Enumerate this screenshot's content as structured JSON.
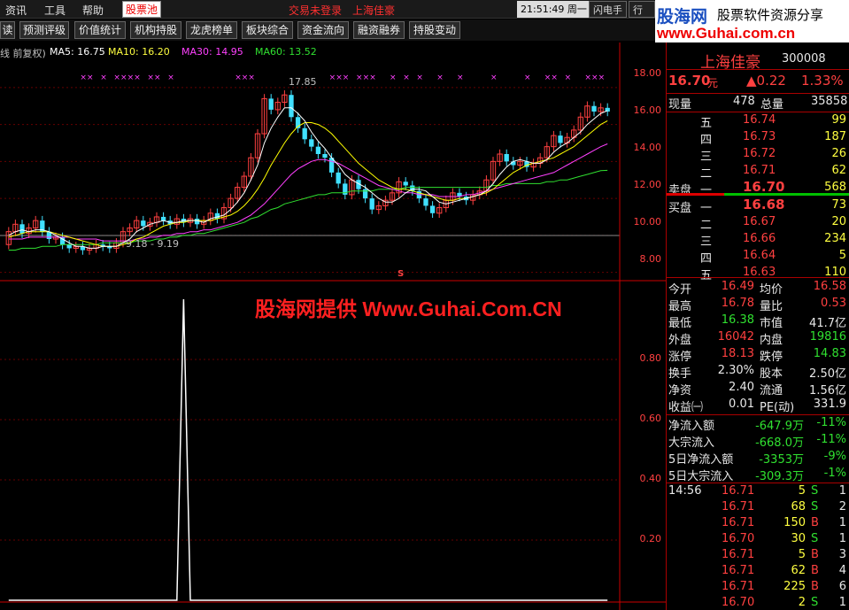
{
  "menu": {
    "items": [
      "资讯",
      "工具",
      "帮助"
    ],
    "active_tab": "股票池",
    "login_status": "交易未登录",
    "stock_title": "上海佳豪",
    "clock": "21:51:49 周一",
    "btn_flash": "闪电手",
    "btn_quote": "行情"
  },
  "toolbar": {
    "buttons": [
      "读",
      "预测评级",
      "价值统计",
      "机构持股",
      "龙虎榜单",
      "板块综合",
      "资金流向",
      "融资融券",
      "持股变动"
    ]
  },
  "logo": {
    "brand": "股海网",
    "tagline": "股票软件资源分享",
    "url": "www.Guhai.com.cn"
  },
  "legend": {
    "prefix": "线 前复权)",
    "ma5": "MA5: 16.75",
    "ma10": "MA10: 16.20",
    "ma30": "MA30: 14.95",
    "ma60": "MA60: 13.52"
  },
  "annotations": {
    "high": "17.85",
    "low": "9.18 - 9.19",
    "marker": "S"
  },
  "watermark": "股海网提供 Www.Guhai.Com.CN",
  "price_axis": [
    "18.00",
    "16.00",
    "14.00",
    "12.00",
    "10.00",
    "8.00"
  ],
  "indicator_axis": [
    "0.80",
    "0.60",
    "0.40",
    "0.20"
  ],
  "colors": {
    "up": "#ff4040",
    "down": "#40e0ff",
    "ma5": "#ffffff",
    "ma10": "#ffff00",
    "ma30": "#ff40ff",
    "ma60": "#30e030"
  },
  "quote": {
    "name": "上海佳豪",
    "code": "300008",
    "price": "16.70",
    "unit": "元",
    "change": "▲0.22",
    "pct": "1.33%",
    "now_vol_label": "现量",
    "now_vol": "478",
    "total_vol_label": "总量",
    "total_vol": "35858",
    "sell_label": "卖盘",
    "buy_label": "买盘",
    "asks": [
      {
        "level": "五",
        "price": "16.74",
        "vol": "99"
      },
      {
        "level": "四",
        "price": "16.73",
        "vol": "187"
      },
      {
        "level": "三",
        "price": "16.72",
        "vol": "26"
      },
      {
        "level": "二",
        "price": "16.71",
        "vol": "62"
      },
      {
        "level": "一",
        "price": "16.70",
        "vol": "568"
      }
    ],
    "bids": [
      {
        "level": "一",
        "price": "16.68",
        "vol": "73"
      },
      {
        "level": "二",
        "price": "16.67",
        "vol": "20"
      },
      {
        "level": "三",
        "price": "16.66",
        "vol": "234"
      },
      {
        "level": "四",
        "price": "16.64",
        "vol": "5"
      },
      {
        "level": "五",
        "price": "16.63",
        "vol": "110"
      }
    ],
    "stats": [
      {
        "l1": "今开",
        "v1": "16.49",
        "l2": "均价",
        "v2": "16.58"
      },
      {
        "l1": "最高",
        "v1": "16.78",
        "l2": "量比",
        "v2": "0.53"
      },
      {
        "l1": "最低",
        "v1": "16.38",
        "l2": "市值",
        "v2": "41.7亿"
      },
      {
        "l1": "外盘",
        "v1": "16042",
        "l2": "内盘",
        "v2": "19816"
      },
      {
        "l1": "涨停",
        "v1": "18.13",
        "l2": "跌停",
        "v2": "14.83"
      },
      {
        "l1": "换手",
        "v1": "2.30%",
        "l2": "股本",
        "v2": "2.50亿"
      },
      {
        "l1": "净资",
        "v1": "2.40",
        "l2": "流通",
        "v2": "1.56亿"
      },
      {
        "l1": "收益㈠",
        "v1": "0.01",
        "l2": "PE(动)",
        "v2": "331.9"
      }
    ],
    "flows": [
      {
        "label": "净流入额",
        "value": "-647.9万",
        "pct": "-11%"
      },
      {
        "label": "大宗流入",
        "value": "-668.0万",
        "pct": "-11%"
      },
      {
        "label": "5日净流入额",
        "value": "-3353万",
        "pct": "-9%"
      },
      {
        "label": "5日大宗流入",
        "value": "-309.3万",
        "pct": "-1%"
      }
    ],
    "ticks": [
      {
        "time": "14:56",
        "price": "16.71",
        "vol": "5",
        "side": "S",
        "n": "1"
      },
      {
        "time": "",
        "price": "16.71",
        "vol": "68",
        "side": "S",
        "n": "2"
      },
      {
        "time": "",
        "price": "16.71",
        "vol": "150",
        "side": "B",
        "n": "1"
      },
      {
        "time": "",
        "price": "16.70",
        "vol": "30",
        "side": "S",
        "n": "1"
      },
      {
        "time": "",
        "price": "16.71",
        "vol": "5",
        "side": "B",
        "n": "3"
      },
      {
        "time": "",
        "price": "16.71",
        "vol": "62",
        "side": "B",
        "n": "4"
      },
      {
        "time": "",
        "price": "16.71",
        "vol": "225",
        "side": "B",
        "n": "6"
      },
      {
        "time": "",
        "price": "16.70",
        "vol": "2",
        "side": "S",
        "n": "1"
      }
    ]
  },
  "chart_data": {
    "type": "candlestick",
    "price_range": [
      7.5,
      19.0
    ],
    "indicator_range": [
      0,
      1.0
    ],
    "candles": [
      [
        9.5,
        10.2
      ],
      [
        10.2,
        10.6
      ],
      [
        10.6,
        10.1
      ],
      [
        10.1,
        10.4
      ],
      [
        10.4,
        10.8
      ],
      [
        10.8,
        10.2
      ],
      [
        10.2,
        9.8
      ],
      [
        9.8,
        9.9
      ],
      [
        9.9,
        9.5
      ],
      [
        9.5,
        9.3
      ],
      [
        9.3,
        9.4
      ],
      [
        9.4,
        9.2
      ],
      [
        9.2,
        9.3
      ],
      [
        9.3,
        9.5
      ],
      [
        9.5,
        9.4
      ],
      [
        9.4,
        9.3
      ],
      [
        9.3,
        9.6
      ],
      [
        9.6,
        10.2
      ],
      [
        10.2,
        10.4
      ],
      [
        10.4,
        10.8
      ],
      [
        10.8,
        10.5
      ],
      [
        10.5,
        10.7
      ],
      [
        10.7,
        11.0
      ],
      [
        11.0,
        10.8
      ],
      [
        10.8,
        10.6
      ],
      [
        10.6,
        10.9
      ],
      [
        10.9,
        10.7
      ],
      [
        10.7,
        10.9
      ],
      [
        10.9,
        10.6
      ],
      [
        10.6,
        10.8
      ],
      [
        10.8,
        11.2
      ],
      [
        11.2,
        10.9
      ],
      [
        10.9,
        11.5
      ],
      [
        11.5,
        12.0
      ],
      [
        12.0,
        12.6
      ],
      [
        12.6,
        13.2
      ],
      [
        13.2,
        14.2
      ],
      [
        14.2,
        15.5
      ],
      [
        15.5,
        17.4
      ],
      [
        17.4,
        16.8
      ],
      [
        16.8,
        17.2
      ],
      [
        17.2,
        17.6
      ],
      [
        17.6,
        16.4
      ],
      [
        16.4,
        15.8
      ],
      [
        15.8,
        15.2
      ],
      [
        15.2,
        14.8
      ],
      [
        14.8,
        14.4
      ],
      [
        14.4,
        14.2
      ],
      [
        14.2,
        13.4
      ],
      [
        13.4,
        12.8
      ],
      [
        12.8,
        12.2
      ],
      [
        12.2,
        13.0
      ],
      [
        13.0,
        12.5
      ],
      [
        12.5,
        12.0
      ],
      [
        12.0,
        11.4
      ],
      [
        11.4,
        11.6
      ],
      [
        11.6,
        11.9
      ],
      [
        11.9,
        12.3
      ],
      [
        12.3,
        12.9
      ],
      [
        12.9,
        12.7
      ],
      [
        12.7,
        12.4
      ],
      [
        12.4,
        12.0
      ],
      [
        12.0,
        11.6
      ],
      [
        11.6,
        11.2
      ],
      [
        11.2,
        11.5
      ],
      [
        11.5,
        11.9
      ],
      [
        11.9,
        12.3
      ],
      [
        12.3,
        12.1
      ],
      [
        12.1,
        11.9
      ],
      [
        11.9,
        12.2
      ],
      [
        12.2,
        12.4
      ],
      [
        12.4,
        13.0
      ],
      [
        13.0,
        14.0
      ],
      [
        14.0,
        14.4
      ],
      [
        14.4,
        14.0
      ],
      [
        14.0,
        13.8
      ],
      [
        13.8,
        14.0
      ],
      [
        14.0,
        13.7
      ],
      [
        13.7,
        13.9
      ],
      [
        13.9,
        14.2
      ],
      [
        14.2,
        14.8
      ],
      [
        14.8,
        15.4
      ],
      [
        15.4,
        15.0
      ],
      [
        15.0,
        15.3
      ],
      [
        15.3,
        15.7
      ],
      [
        15.7,
        16.4
      ],
      [
        16.4,
        17.0
      ],
      [
        17.0,
        16.7
      ],
      [
        16.7,
        16.9
      ],
      [
        16.9,
        16.7
      ]
    ],
    "ma5": [
      10.0,
      10.2,
      10.3,
      10.2,
      10.3,
      10.3,
      10.2,
      10.0,
      9.8,
      9.6,
      9.4,
      9.4,
      9.3,
      9.3,
      9.4,
      9.4,
      9.4,
      9.6,
      9.8,
      10.2,
      10.4,
      10.6,
      10.7,
      10.8,
      10.7,
      10.7,
      10.8,
      10.8,
      10.8,
      10.7,
      10.9,
      11.0,
      11.1,
      11.4,
      11.8,
      12.3,
      13.0,
      13.8,
      15.0,
      15.8,
      16.4,
      16.9,
      16.9,
      16.6,
      16.2,
      15.6,
      15.1,
      14.7,
      14.2,
      13.8,
      13.3,
      13.0,
      12.8,
      12.6,
      12.3,
      12.0,
      11.8,
      11.8,
      12.0,
      12.3,
      12.5,
      12.5,
      12.4,
      12.1,
      11.8,
      11.7,
      11.8,
      11.9,
      12.0,
      12.1,
      12.2,
      12.4,
      12.8,
      13.3,
      13.7,
      14.0,
      14.1,
      14.0,
      13.9,
      13.9,
      14.1,
      14.5,
      14.8,
      15.0,
      15.3,
      15.6,
      16.0,
      16.3,
      16.6,
      16.75
    ],
    "ma10": [
      9.9,
      10.0,
      10.1,
      10.2,
      10.2,
      10.2,
      10.2,
      10.1,
      10.0,
      9.9,
      9.8,
      9.7,
      9.6,
      9.5,
      9.4,
      9.4,
      9.4,
      9.5,
      9.6,
      9.8,
      9.9,
      10.1,
      10.3,
      10.5,
      10.6,
      10.7,
      10.7,
      10.8,
      10.8,
      10.8,
      10.8,
      10.9,
      11.0,
      11.1,
      11.3,
      11.6,
      12.0,
      12.5,
      13.1,
      13.8,
      14.4,
      15.0,
      15.5,
      15.9,
      16.1,
      16.1,
      16.0,
      15.8,
      15.5,
      15.1,
      14.7,
      14.3,
      13.9,
      13.6,
      13.3,
      13.0,
      12.8,
      12.6,
      12.5,
      12.5,
      12.4,
      12.3,
      12.2,
      12.1,
      12.0,
      11.9,
      11.9,
      12.0,
      12.0,
      12.1,
      12.2,
      12.3,
      12.5,
      12.8,
      13.1,
      13.4,
      13.6,
      13.8,
      13.9,
      14.0,
      14.1,
      14.2,
      14.4,
      14.6,
      14.8,
      15.1,
      15.4,
      15.7,
      16.0,
      16.2
    ],
    "ma30": [
      9.8,
      9.8,
      9.8,
      9.9,
      9.9,
      9.9,
      9.9,
      9.9,
      9.9,
      9.9,
      9.8,
      9.8,
      9.8,
      9.8,
      9.7,
      9.7,
      9.7,
      9.7,
      9.7,
      9.8,
      9.8,
      9.9,
      9.9,
      10.0,
      10.0,
      10.1,
      10.1,
      10.2,
      10.2,
      10.3,
      10.3,
      10.4,
      10.5,
      10.6,
      10.7,
      10.9,
      11.1,
      11.4,
      11.7,
      12.1,
      12.5,
      12.9,
      13.3,
      13.6,
      13.8,
      14.0,
      14.1,
      14.1,
      14.0,
      13.9,
      13.7,
      13.5,
      13.3,
      13.1,
      12.9,
      12.7,
      12.6,
      12.5,
      12.4,
      12.3,
      12.3,
      12.2,
      12.2,
      12.2,
      12.1,
      12.1,
      12.1,
      12.1,
      12.2,
      12.2,
      12.3,
      12.4,
      12.5,
      12.6,
      12.7,
      12.8,
      12.9,
      13.0,
      13.1,
      13.2,
      13.3,
      13.4,
      13.6,
      13.8,
      14.0,
      14.2,
      14.4,
      14.6,
      14.8,
      14.95
    ],
    "ma60": [
      9.2,
      9.2,
      9.3,
      9.3,
      9.3,
      9.4,
      9.4,
      9.4,
      9.5,
      9.5,
      9.5,
      9.5,
      9.5,
      9.5,
      9.6,
      9.6,
      9.6,
      9.6,
      9.6,
      9.7,
      9.7,
      9.7,
      9.8,
      9.8,
      9.9,
      9.9,
      10.0,
      10.0,
      10.1,
      10.1,
      10.2,
      10.3,
      10.4,
      10.5,
      10.6,
      10.7,
      10.9,
      11.0,
      11.2,
      11.4,
      11.5,
      11.7,
      11.8,
      11.9,
      12.0,
      12.1,
      12.2,
      12.2,
      12.3,
      12.3,
      12.3,
      12.4,
      12.4,
      12.4,
      12.4,
      12.5,
      12.5,
      12.5,
      12.5,
      12.6,
      12.6,
      12.6,
      12.6,
      12.6,
      12.6,
      12.6,
      12.6,
      12.6,
      12.6,
      12.6,
      12.6,
      12.6,
      12.7,
      12.7,
      12.8,
      12.8,
      12.8,
      12.8,
      12.8,
      12.8,
      12.9,
      12.9,
      13.0,
      13.0,
      13.1,
      13.2,
      13.3,
      13.4,
      13.5,
      13.52
    ],
    "indicator": [
      0,
      0,
      0,
      0,
      0,
      0,
      0,
      0,
      0,
      0,
      0,
      0,
      0,
      0,
      0,
      0,
      0,
      0,
      0,
      0,
      0,
      0,
      0,
      0,
      0,
      0,
      1.0,
      0,
      0,
      0,
      0,
      0,
      0,
      0,
      0,
      0,
      0,
      0,
      0,
      0,
      0,
      0,
      0,
      0,
      0,
      0,
      0,
      0,
      0,
      0,
      0,
      0,
      0,
      0,
      0,
      0,
      0,
      0,
      0,
      0,
      0,
      0,
      0,
      0,
      0,
      0,
      0,
      0,
      0,
      0,
      0,
      0,
      0,
      0,
      0,
      0,
      0,
      0,
      0,
      0,
      0,
      0,
      0,
      0,
      0,
      0,
      0,
      0,
      0,
      0
    ]
  }
}
